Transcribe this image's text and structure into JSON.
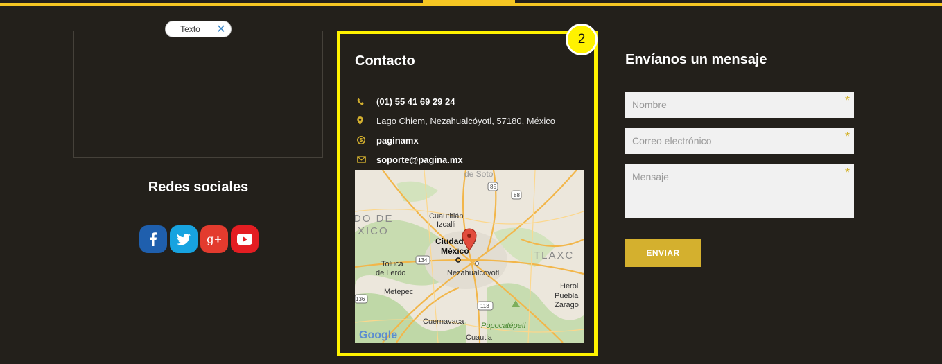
{
  "text_widget": {
    "tag_label": "Texto",
    "close_symbol": "✕"
  },
  "social": {
    "title": "Redes sociales",
    "links": [
      {
        "icon": "facebook-icon",
        "color": "#1f5fad"
      },
      {
        "icon": "twitter-icon",
        "color": "#17a3e0"
      },
      {
        "icon": "google-plus-icon",
        "color": "#e33b2e"
      },
      {
        "icon": "youtube-icon",
        "color": "#e41d22"
      }
    ]
  },
  "contact": {
    "badge": "2",
    "title": "Contacto",
    "phone": "(01) 55 41 69 29 24",
    "address": "Lago Chiem, Nezahualcóyotl, 57180, México",
    "skype": "paginamx",
    "email": "soporte@pagina.mx",
    "icon_color": "#d4b02e",
    "map": {
      "labels": [
        "de Soto",
        "85",
        "88",
        "DO DE",
        "XICO",
        "Cuautitlán",
        "Izcalli",
        "Ciudad de",
        "México",
        "TLAXC",
        "Toluca",
        "de Lerdo",
        "134",
        "Nezahualcóyotl",
        "Metepec",
        "136",
        "Heroi",
        "Puebla",
        "Zarago",
        "113",
        "Cuernavaca",
        "Popocatépetl",
        "Cuautla",
        "Google"
      ]
    }
  },
  "form": {
    "title": "Envíanos un mensaje",
    "name_placeholder": "Nombre",
    "email_placeholder": "Correo electrónico",
    "message_placeholder": "Mensaje",
    "required_mark": "*",
    "submit_label": "ENVIAR",
    "accent": "#d4b02e"
  },
  "colors": {
    "background": "#23201b",
    "top_bar": "#f5c623",
    "highlight": "#fff200"
  }
}
